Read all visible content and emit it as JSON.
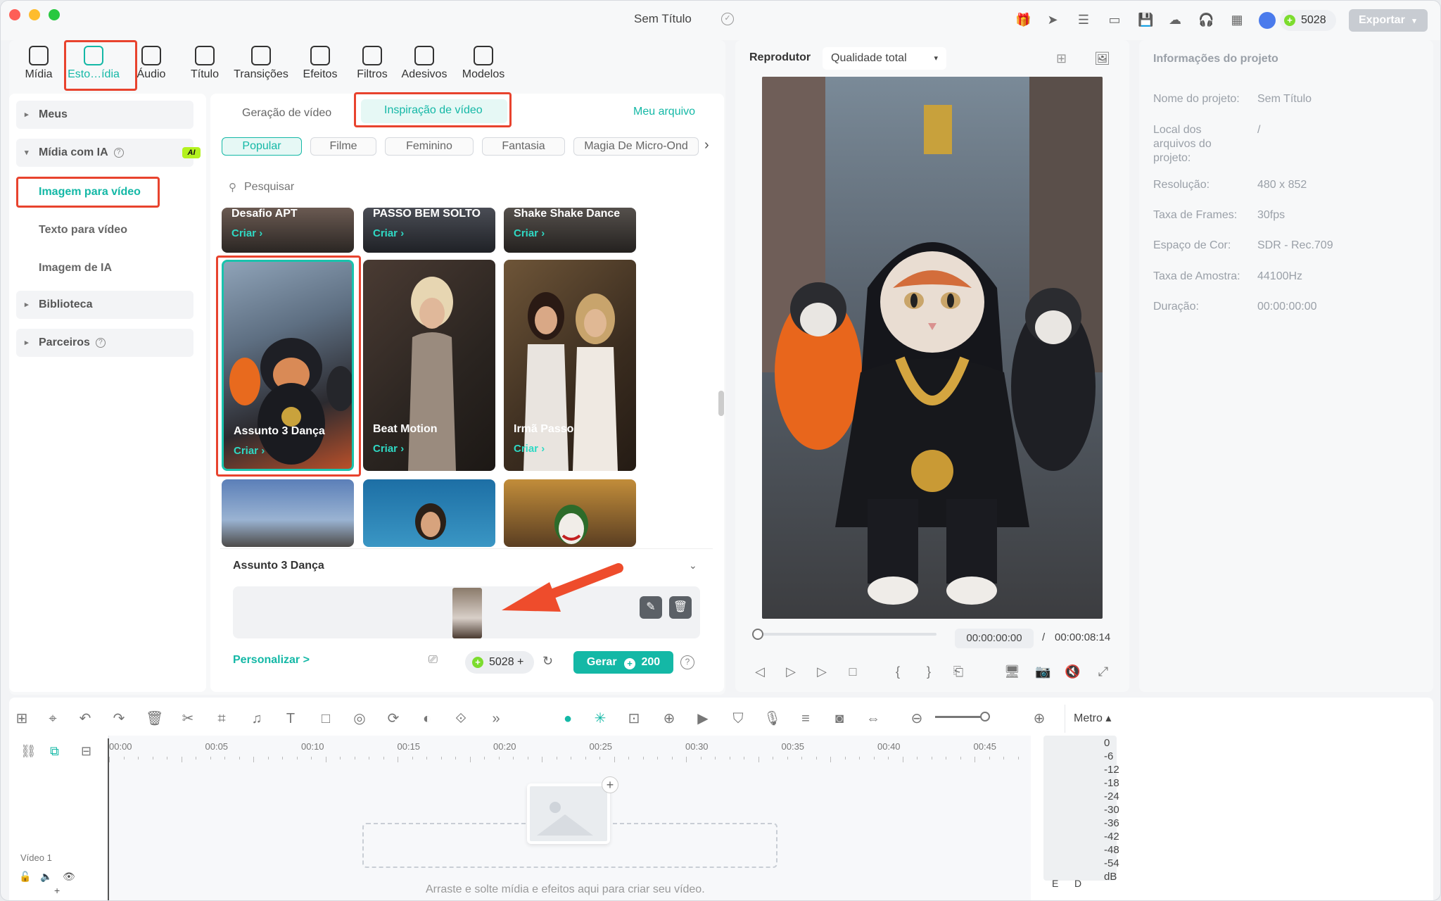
{
  "window": {
    "title": "Sem Título",
    "credits": "5028",
    "export_label": "Exportar"
  },
  "toolbar": {
    "items": [
      {
        "label": "Mídia",
        "icon": "media-icon"
      },
      {
        "label": "Esto…ídia",
        "icon": "store-icon",
        "active": true
      },
      {
        "label": "Áudio",
        "icon": "music-note-icon"
      },
      {
        "label": "Título",
        "icon": "text-t-icon"
      },
      {
        "label": "Transições",
        "icon": "transition-icon"
      },
      {
        "label": "Efeitos",
        "icon": "effects-icon"
      },
      {
        "label": "Filtros",
        "icon": "filter-icon"
      },
      {
        "label": "Adesivos",
        "icon": "sticker-icon"
      },
      {
        "label": "Modelos",
        "icon": "template-icon"
      }
    ]
  },
  "sidebar": {
    "meus": "Meus",
    "midia_ia": "Mídia com IA",
    "ai_badge": "AI",
    "imagem_video": "Imagem para vídeo",
    "texto_video": "Texto para vídeo",
    "imagem_ia": "Imagem de IA",
    "biblioteca": "Biblioteca",
    "parceiros": "Parceiros"
  },
  "browser": {
    "tabs": {
      "geracao": "Geração de vídeo",
      "inspiracao": "Inspiração de vídeo",
      "meu_arquivo": "Meu arquivo"
    },
    "chips": [
      "Popular",
      "Filme",
      "Feminino",
      "Fantasia",
      "Magia De Micro-Ond"
    ],
    "search_placeholder": "Pesquisar",
    "cta": "Criar",
    "cards_top": [
      "Desafio APT",
      "PASSO BEM SOLTO",
      "Shake Shake Dance"
    ],
    "cards_mid": [
      "Assunto 3 Dança",
      "Beat Motion",
      "Irmã Passo"
    ]
  },
  "generator": {
    "title": "Assunto 3 Dança",
    "personalize": "Personalizar >",
    "credits": "5028",
    "generate_label": "Gerar",
    "cost": "200"
  },
  "player": {
    "title": "Reprodutor",
    "quality": "Qualidade total",
    "current_time": "00:00:00:00",
    "separator": "/",
    "total_time": "00:00:08:14",
    "progress": 0
  },
  "project_info": {
    "heading": "Informações do projeto",
    "rows": [
      {
        "label": "Nome do projeto:",
        "value": "Sem Título"
      },
      {
        "label": "Local dos arquivos do projeto:",
        "value": "/"
      },
      {
        "label": "Resolução:",
        "value": "480 x 852"
      },
      {
        "label": "Taxa de Frames:",
        "value": "30fps"
      },
      {
        "label": "Espaço de Cor:",
        "value": "SDR - Rec.709"
      },
      {
        "label": "Taxa de Amostra:",
        "value": "44100Hz"
      },
      {
        "label": "Duração:",
        "value": "00:00:00:00"
      }
    ]
  },
  "timeline": {
    "ruler": [
      "00:00",
      "00:05",
      "00:10",
      "00:15",
      "00:20",
      "00:25",
      "00:30",
      "00:35",
      "00:40",
      "00:45"
    ],
    "metro": "Metro",
    "track_label": "Vídeo 1",
    "drop_hint": "Arraste e solte mídia e efeitos aqui para criar seu vídeo.",
    "db_scale": [
      "0",
      "-6",
      "-12",
      "-18",
      "-24",
      "-30",
      "-36",
      "-42",
      "-48",
      "-54",
      "dB"
    ],
    "channels": [
      "E",
      "D"
    ]
  },
  "colors": {
    "accent": "#14b8a6",
    "highlight": "#e8432e",
    "ai_badge": "#b4f21f",
    "credit": "#7cdc2e"
  }
}
